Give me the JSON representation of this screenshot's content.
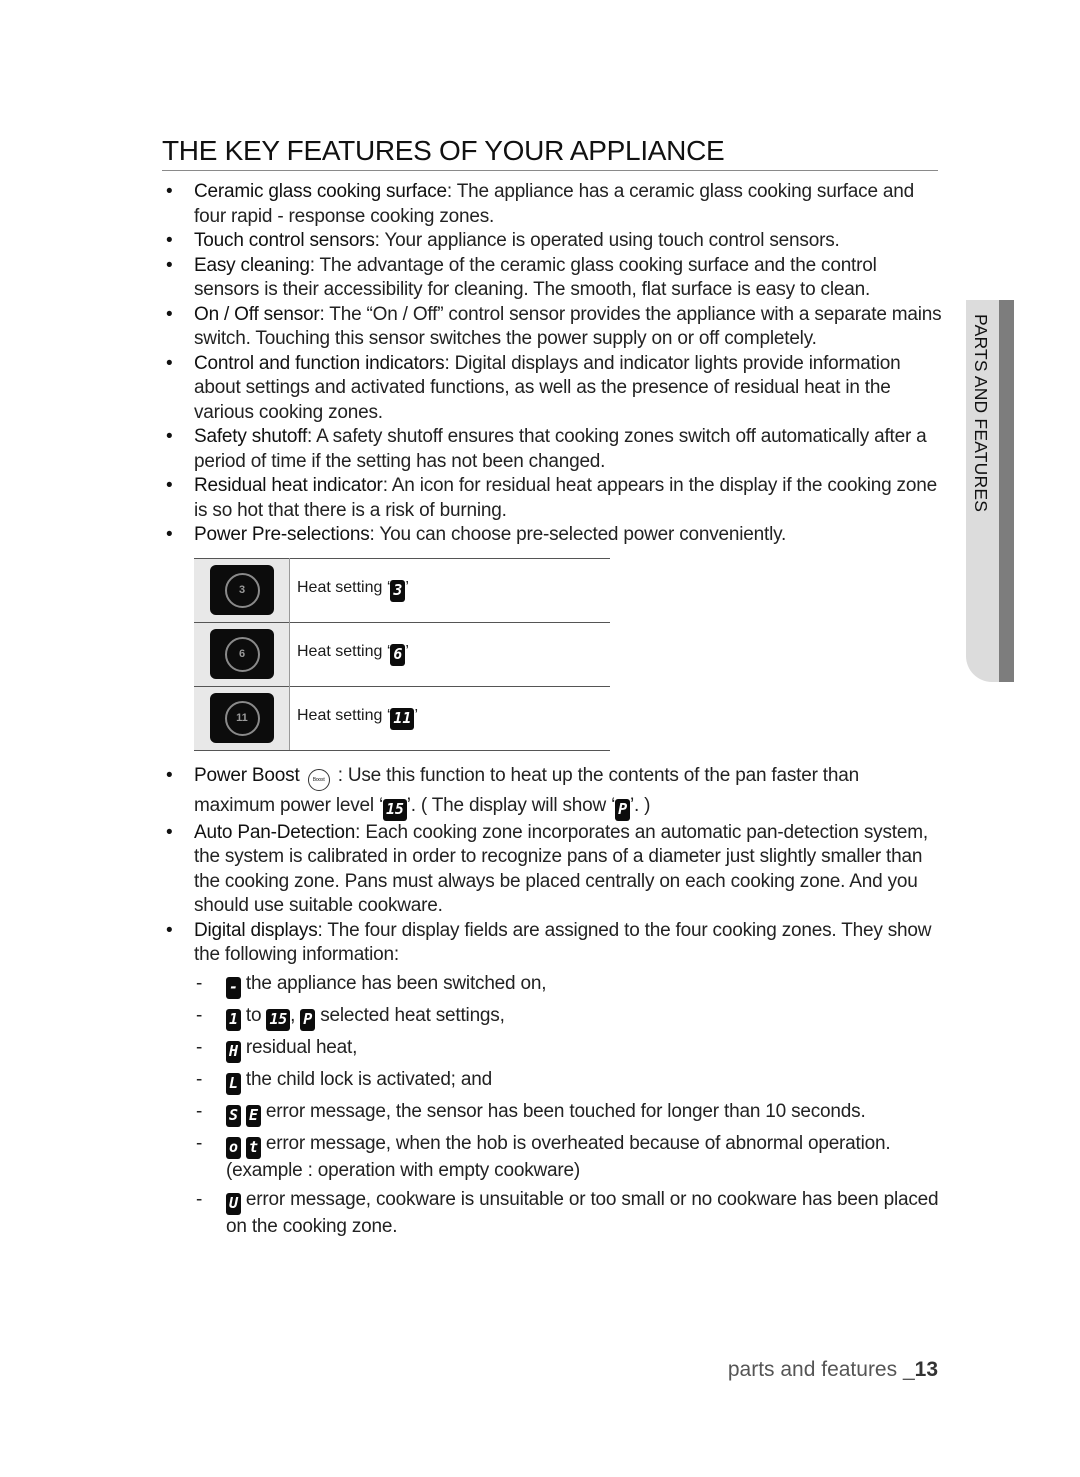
{
  "title": "THE KEY FEATURES OF YOUR APPLIANCE",
  "features": [
    {
      "term": "Ceramic glass cooking surface",
      "text": ": The appliance has a ceramic glass cooking surface and four rapid - response cooking zones."
    },
    {
      "term": "Touch control sensors",
      "text": ": Your appliance is operated using touch control sensors."
    },
    {
      "term": "Easy cleaning",
      "text": ": The advantage of the ceramic glass cooking surface and the control sensors is their accessibility for cleaning. The smooth, flat surface is easy to clean."
    },
    {
      "term": "On / Off sensor",
      "text": ": The “On / Off” control sensor provides the appliance with a separate mains switch. Touching this sensor switches the power supply on or off completely."
    },
    {
      "term": "Control and function indicators",
      "text": ": Digital displays and indicator lights provide information about settings and activated functions, as well as the presence of residual heat in the various cooking zones."
    },
    {
      "term": "Safety shutoff",
      "text": ": A safety shutoff ensures that cooking zones switch off automatically after a period of time if the setting has not been changed."
    },
    {
      "term": "Residual heat indicator",
      "text": ": An icon for residual heat appears in the display if the cooking zone is so hot that there is a risk of burning."
    },
    {
      "term": "Power Pre-selections",
      "text": ": You can choose pre-selected power conveniently."
    }
  ],
  "preselection_table": [
    {
      "button": "3",
      "label": "Heat setting ‘",
      "display": "3",
      "close": "’"
    },
    {
      "button": "6",
      "label": "Heat setting ‘",
      "display": "6",
      "close": "’"
    },
    {
      "button": "11",
      "label": "Heat setting ‘",
      "display": "11",
      "close": "’"
    }
  ],
  "power_boost": {
    "term": "Power Boost",
    "icon_label": "Boost",
    "text1": " : Use this function to heat up the contents of the pan faster than maximum power level ‘",
    "display1": "15",
    "text2": "’. ( The display will show ‘",
    "display2": "P",
    "text3": "’. )"
  },
  "auto_pan": {
    "term": "Auto Pan-Detection",
    "text": ": Each cooking zone incorporates an automatic pan-detection system, the system is calibrated in order to recognize pans of a diameter just slightly smaller than the cooking zone. Pans must always be placed centrally on each cooking zone. And you should use suitable cookware."
  },
  "digital_displays": {
    "term": "Digital displays",
    "text": ": The four display fields are assigned to the four cooking zones. They show the following information:",
    "items": [
      {
        "codes": [
          "-"
        ],
        "text": " the appliance has been switched on,"
      },
      {
        "codes": [
          "1"
        ],
        "mid": " to ",
        "codes2": [
          "15"
        ],
        "sep": ", ",
        "codes3": [
          "P"
        ],
        "text": " selected heat settings,"
      },
      {
        "codes": [
          "H"
        ],
        "text": " residual heat,"
      },
      {
        "codes": [
          "L"
        ],
        "text": " the child lock is activated; and"
      },
      {
        "codes": [
          "S",
          "E"
        ],
        "text": " error message, the sensor has been touched for longer than 10 seconds."
      },
      {
        "codes": [
          "o",
          "t"
        ],
        "text": " error message, when the hob is overheated because of abnormal operation. (example : operation with empty cookware)"
      },
      {
        "codes": [
          "U"
        ],
        "text": " error message, cookware is unsuitable or too small or no cookware has been placed on the cooking zone."
      }
    ]
  },
  "side_tab": "PARTS AND FEATURES",
  "footer": {
    "section": "parts and features _",
    "page": "13"
  }
}
